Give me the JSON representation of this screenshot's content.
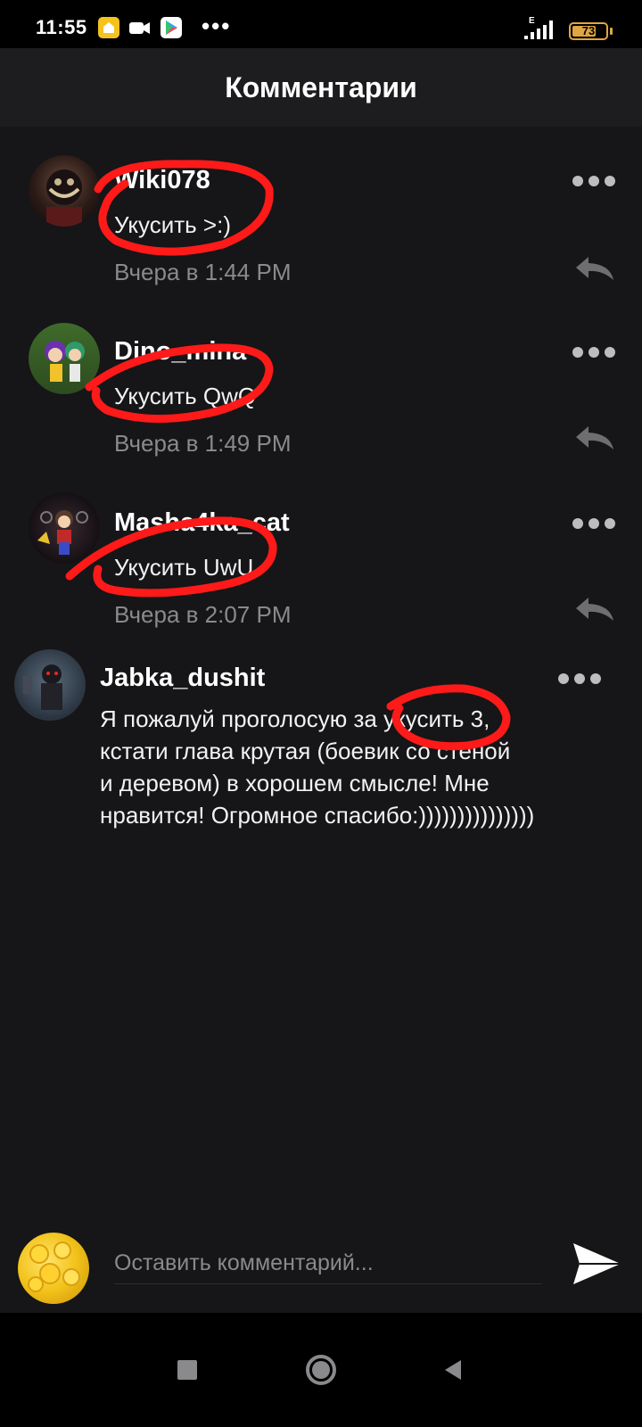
{
  "status_bar": {
    "time": "11:55",
    "network_type": "E",
    "battery_level": "73",
    "battery_percent": 73,
    "app_icons": [
      "home-app-icon",
      "video-camera-app-icon",
      "play-store-icon"
    ],
    "more_indicator": "•••"
  },
  "header": {
    "title": "Комментарии"
  },
  "comments": [
    {
      "username": "Wiki078",
      "text": "Укусить >:)",
      "time": "Вчера в 1:44 PM",
      "has_reply": true
    },
    {
      "username": "Dino_mina",
      "text": "Укусить QwQ",
      "time": "Вчера в 1:49 PM",
      "has_reply": true
    },
    {
      "username": "Masha4ka_cat",
      "text": "Укусить UwU",
      "time": "Вчера в 2:07 PM",
      "has_reply": true
    },
    {
      "username": "Jabka_dushit",
      "text_lines": [
        "Я пожалуй проголосую за укусить 3,",
        "кстати глава крутая (боевик со стеной",
        "и деревом) в хорошем смысле! Мне",
        "нравится! Огромное спасибо:)))))))))))))))"
      ],
      "has_reply": false
    }
  ],
  "input": {
    "placeholder": "Оставить комментарий..."
  },
  "colors": {
    "background": "#161517",
    "header": "#1d1c1e",
    "annotation": "#ff1a1a",
    "muted_text": "#8a898c",
    "battery": "#e0a640"
  }
}
